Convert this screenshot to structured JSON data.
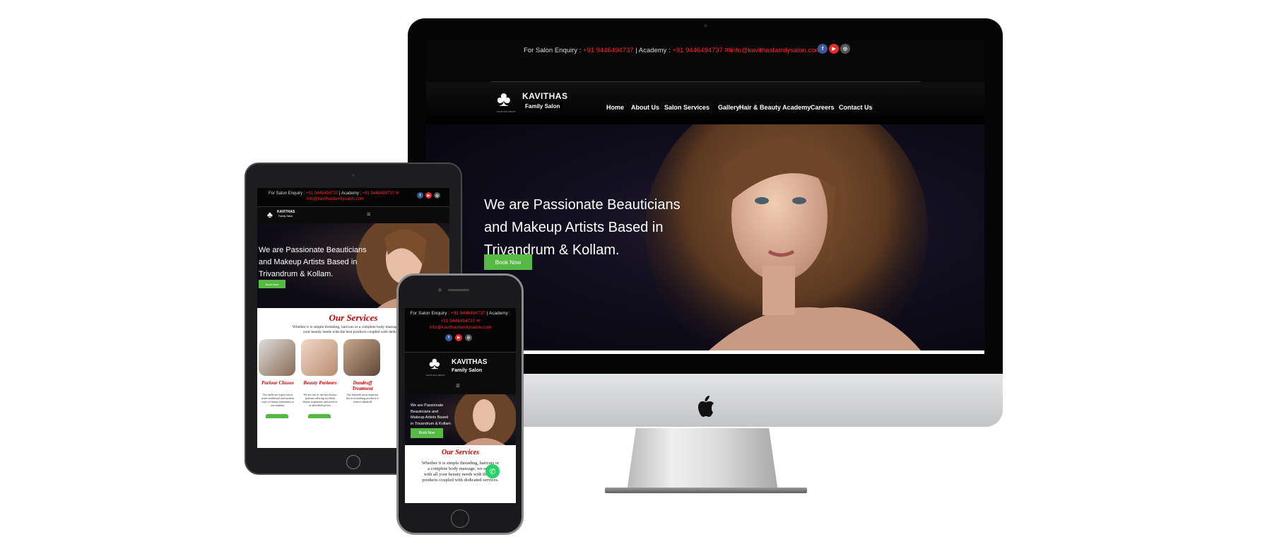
{
  "desktop": {
    "contact_prefix": "For Salon Enquiry :",
    "salon_phone": "+91 9446494737",
    "academy_label": "| Academy :",
    "academy_phone": "+91 9446494737",
    "email": "info@kavithasfamilysalon.com",
    "logo_title": "KAVITHAS",
    "logo_subtitle": "Family Salon",
    "logo_group": "KAVITHAS GROUP",
    "nav": [
      "Home",
      "About Us",
      "Salon Services",
      "Gallery",
      "Hair & Beauty Academy",
      "Careers",
      "Contact Us"
    ],
    "hero_line1": "We are Passionate Beauticians",
    "hero_line2": "and Makeup Artists Based in",
    "hero_line3": "Trivandrum & Kollam.",
    "cta_label": "Book Now"
  },
  "tablet": {
    "contact_prefix": "For Salon Enquiry :",
    "salon_phone": "+91 9446494737",
    "academy_label": "| Academy :",
    "academy_phone": "+91 9446494737",
    "email": "info@kavithasfamilysalon.com",
    "logo_title": "KAVITHAS",
    "logo_subtitle": "Family Salon",
    "hero_line1": "We are Passionate Beauticians",
    "hero_line2": "and Makeup Artists Based in",
    "hero_line3": "Trivandrum & Kollam.",
    "cta_label": "Book Now",
    "services_title": "Our Services",
    "services_intro_1": "Whether it is simple threading, haircuts or a complete body massage, we serve",
    "services_intro_2": "your beauty needs with the best products coupled with dedicated",
    "services": [
      {
        "name": "Parlour Classes",
        "desc": "Our skills are expert tutors teach traditional and modern ways of beauty treatments to our students."
      },
      {
        "name": "Beauty Parlours",
        "desc": "We are one of the best beauty parlours offering excellent beauty treatments and services at affordable prices."
      },
      {
        "name": "Dandruff Treatment",
        "desc": "Our beautification expertise lies in everything products to remove dandruff"
      }
    ]
  },
  "phone": {
    "contact_prefix": "For Salon Enquiry :",
    "salon_phone": "+91 9446494737",
    "academy_label": "| Academy :",
    "academy_phone": "+91 9446494737",
    "email": "info@kavithasfamilysalon.com",
    "logo_title": "KAVITHAS",
    "logo_subtitle": "Family Salon",
    "logo_group": "KAVITHAS GROUP",
    "hero_line1": "We are Passionate",
    "hero_line2": "Beauticians and",
    "hero_line3": "Makeup Artists Based",
    "hero_line4": "in Trivandrum & Kollam",
    "cta_label": "Book Now",
    "services_title": "Our Services",
    "services_intro_1": "Whether it is simple threading, haircuts or",
    "services_intro_2": "a complete body massage, we serve",
    "services_intro_3": "with all your beauty needs with the best",
    "services_intro_4": "products coupled with dedicated services."
  },
  "colors": {
    "accent_green": "#56b944",
    "accent_red": "#ff2a2a",
    "service_red": "#cc0000",
    "facebook": "#3b5998",
    "youtube": "#e52d27",
    "whatsapp": "#25d366"
  },
  "icons": [
    "facebook-icon",
    "youtube-icon",
    "instagram-icon",
    "mail-icon",
    "apple-logo-icon",
    "hamburger-menu-icon",
    "whatsapp-icon",
    "clover-logo-icon"
  ]
}
